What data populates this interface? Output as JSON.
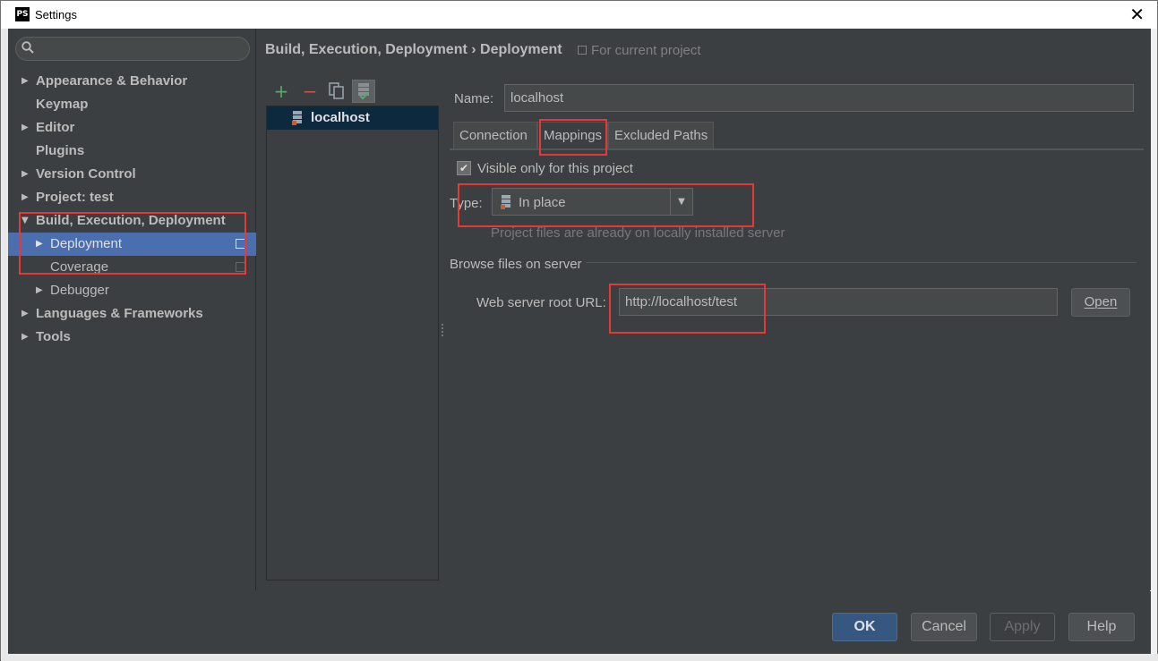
{
  "window": {
    "title": "Settings",
    "app_icon": "PS"
  },
  "sidebar": {
    "search_placeholder": "",
    "items": [
      {
        "label": "Appearance & Behavior",
        "arrow": "▶",
        "level": 0
      },
      {
        "label": "Keymap",
        "arrow": "",
        "level": 0
      },
      {
        "label": "Editor",
        "arrow": "▶",
        "level": 0
      },
      {
        "label": "Plugins",
        "arrow": "",
        "level": 0
      },
      {
        "label": "Version Control",
        "arrow": "▶",
        "level": 0
      },
      {
        "label": "Project: test",
        "arrow": "▶",
        "level": 0
      },
      {
        "label": "Build, Execution, Deployment",
        "arrow": "▼",
        "level": 0
      },
      {
        "label": "Deployment",
        "arrow": "▶",
        "level": 1,
        "selected": true
      },
      {
        "label": "Coverage",
        "arrow": "",
        "level": 1
      },
      {
        "label": "Debugger",
        "arrow": "▶",
        "level": 1
      },
      {
        "label": "Languages & Frameworks",
        "arrow": "▶",
        "level": 0
      },
      {
        "label": "Tools",
        "arrow": "▶",
        "level": 0
      }
    ]
  },
  "header": {
    "breadcrumb": "Build, Execution, Deployment › Deployment",
    "scope": "For current project"
  },
  "toolbar": {
    "add": "+",
    "remove": "−"
  },
  "servers": [
    {
      "name": "localhost"
    }
  ],
  "form": {
    "name_label": "Name:",
    "name_value": "localhost",
    "tabs": [
      "Connection",
      "Mappings",
      "Excluded Paths"
    ],
    "visible_only_label": "Visible only for this project",
    "visible_only_checked": "✔",
    "type_label": "Type:",
    "type_value": "In place",
    "type_hint": "Project files are already on locally installed server",
    "browse_section": "Browse files on server",
    "url_label": "Web server root URL:",
    "url_value": "http://localhost/test",
    "open_label": "Open"
  },
  "footer": {
    "ok": "OK",
    "cancel": "Cancel",
    "apply": "Apply",
    "help": "Help"
  },
  "colors": {
    "selection": "#4b6eaf",
    "highlight_box": "#e53935",
    "ok_button": "#365880"
  }
}
